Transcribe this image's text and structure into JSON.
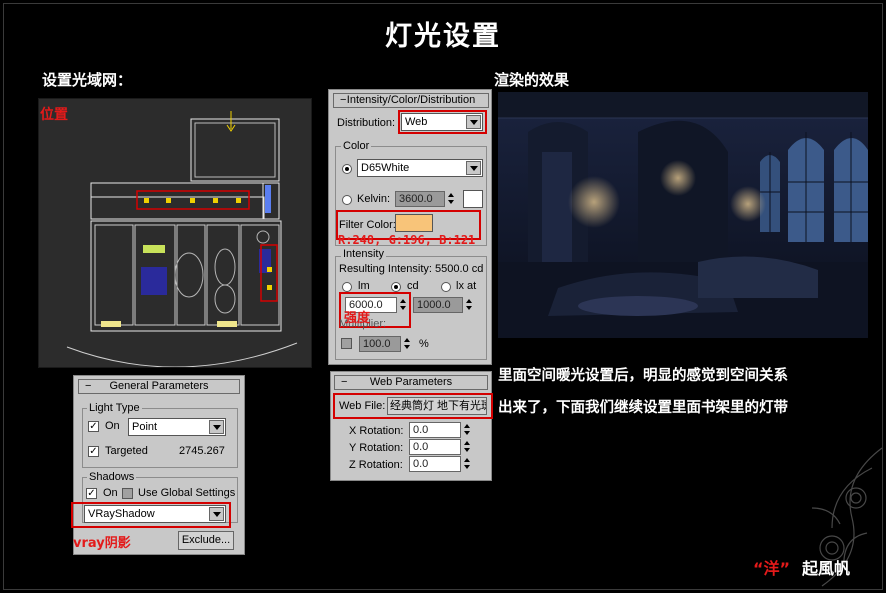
{
  "title": "灯光设置",
  "left_heading": "设置光域网：",
  "right_heading": "渲染的效果",
  "labels": {
    "position": "位置",
    "brightness": "强度",
    "rgb": "R:248, G:196, B:121",
    "vray_shadow": "vray阴影"
  },
  "intensity_panel": {
    "header": "Intensity/Color/Distribution",
    "distribution_label": "Distribution:",
    "distribution_value": "Web",
    "color_group": "Color",
    "preset_value": "D65White",
    "kelvin_label": "Kelvin:",
    "kelvin_value": "3600.0",
    "filter_color_label": "Filter Color:",
    "filter_color": "#f8c479",
    "intensity_group": "Intensity",
    "resulting_intensity": "Resulting Intensity: 5500.0 cd",
    "unit_lm": "lm",
    "unit_cd": "cd",
    "unit_lxat": "lx at",
    "intensity_value": "6000.0",
    "distance_value": "1000.0",
    "multiplier_label": "Multiplier:",
    "multiplier_value": "100.0",
    "percent": "%"
  },
  "web_panel": {
    "header": "Web Parameters",
    "web_file_label": "Web File:",
    "web_file_value": "经典筒灯 地下有光斑",
    "x_rotation_label": "X Rotation:",
    "x_rotation_value": "0.0",
    "y_rotation_label": "Y Rotation:",
    "y_rotation_value": "0.0",
    "z_rotation_label": "Z Rotation:",
    "z_rotation_value": "0.0"
  },
  "general_panel": {
    "header": "General Parameters",
    "light_type_group": "Light Type",
    "on_label": "On",
    "light_type_value": "Point",
    "targeted_label": "Targeted",
    "target_distance": "2745.267",
    "shadows_group": "Shadows",
    "shadows_on_label": "On",
    "use_global_label": "Use Global Settings",
    "shadow_type": "VRayShadow",
    "exclude_label": "Exclude..."
  },
  "description_lines": [
    "里面空间暖光设置后，明显的感觉到空间关系",
    "出来了，下面我们继续设置里面书架里的灯带"
  ],
  "signature": {
    "quote_open": "“",
    "name_part": "洋",
    "quote_close": "”",
    "rest": "起風帆"
  },
  "colors": {
    "accent_red": "#e31a1a",
    "panel_bg": "#c8c8c8",
    "filter_swatch": "#f8c479"
  }
}
